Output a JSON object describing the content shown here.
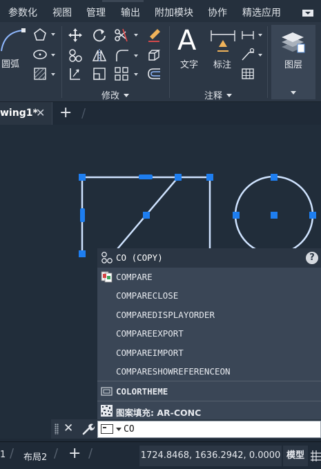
{
  "menubar": {
    "items": [
      "参数化",
      "视图",
      "管理",
      "输出",
      "附加模块",
      "协作",
      "精选应用"
    ]
  },
  "ribbon": {
    "draw": {
      "arc_label": "圆弧"
    },
    "modify": {
      "title": "修改"
    },
    "annotation": {
      "title": "注释",
      "text_label": "文字",
      "text_glyph": "A",
      "dimension_label": "标注"
    },
    "layers": {
      "label": "图层"
    }
  },
  "tabs": {
    "document": "wing1*",
    "close": "✕",
    "add": "+"
  },
  "autocomplete": {
    "header": "CO (COPY)",
    "help": "?",
    "items": [
      {
        "label": "COMPARE",
        "icon": "compare-icon"
      },
      {
        "label": "COMPARECLOSE"
      },
      {
        "label": "COMPAREDISPLAYORDER"
      },
      {
        "label": "COMPAREEXPORT"
      },
      {
        "label": "COMPAREIMPORT"
      },
      {
        "label": "COMPARESHOWREFERENCEON"
      },
      {
        "label": "COLORTHEME",
        "icon": "colortheme-icon"
      },
      {
        "label": "图案填充: AR-CONC",
        "icon": "hatch-pattern-icon"
      }
    ]
  },
  "command_line": {
    "close": "✕",
    "value": "CO"
  },
  "statusbar": {
    "layout_1": "1",
    "layout_2": "布局2",
    "add": "+",
    "coordinates": "1724.8468, 1636.2942, 0.0000",
    "model": "模型"
  },
  "colors": {
    "canvas": "#212d3a",
    "selection_grip": "#1e7ef0",
    "geometry": "#cfe3ff"
  }
}
